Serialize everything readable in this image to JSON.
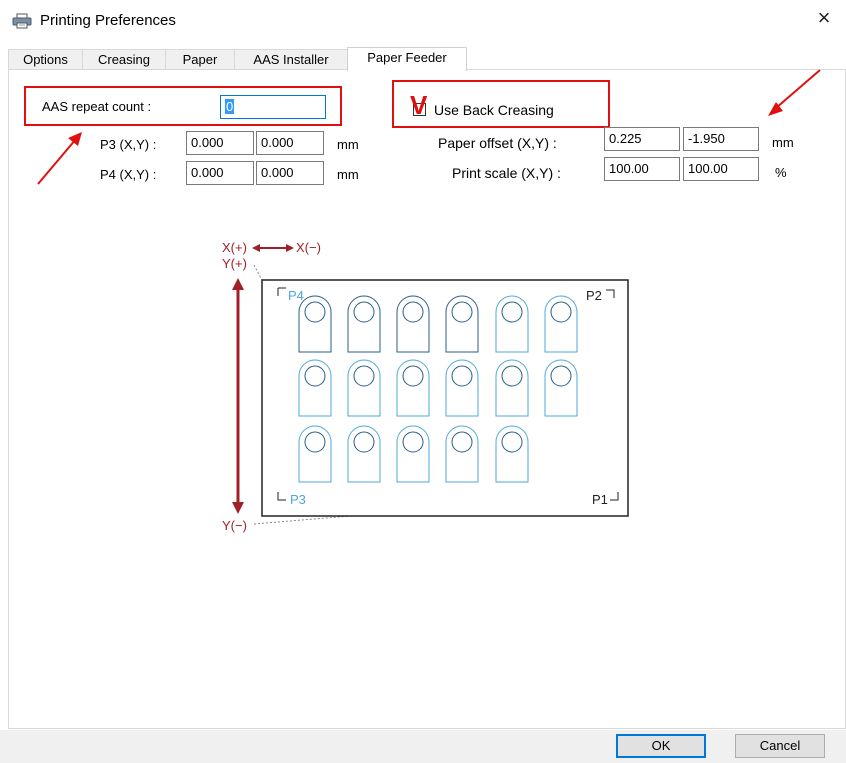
{
  "window": {
    "title": "Printing Preferences",
    "close_symbol": "×"
  },
  "tabs": [
    "Options",
    "Creasing",
    "Paper",
    "AAS Installer",
    "Paper Feeder"
  ],
  "active_tab": "Paper Feeder",
  "aas": {
    "label": "AAS repeat count :",
    "value": "0"
  },
  "p3": {
    "label": "P3 (X,Y) :",
    "x": "0.000",
    "y": "0.000",
    "unit": "mm"
  },
  "p4": {
    "label": "P4 (X,Y) :",
    "x": "0.000",
    "y": "0.000",
    "unit": "mm"
  },
  "back_creasing": {
    "label": "Use Back Creasing",
    "checked": true,
    "mark": "V"
  },
  "paper_offset": {
    "label": "Paper offset (X,Y) :",
    "x": "0.225",
    "y": "-1.950",
    "unit": "mm"
  },
  "print_scale": {
    "label": "Print scale (X,Y) :",
    "x": "100.00",
    "y": "100.00",
    "unit": "%"
  },
  "diagram": {
    "x_plus": "X(+)",
    "x_minus": "X(−)",
    "y_plus": "Y(+)",
    "y_minus": "Y(−)",
    "p1": "P1",
    "p2": "P2",
    "p3": "P3",
    "p4": "P4"
  },
  "buttons": {
    "ok": "OK",
    "cancel": "Cancel"
  },
  "colors": {
    "annotation_red": "#e01010",
    "diagram_red": "#a0202a",
    "diagram_blue": "#4fa8d8",
    "focus_blue": "#0078d7"
  }
}
